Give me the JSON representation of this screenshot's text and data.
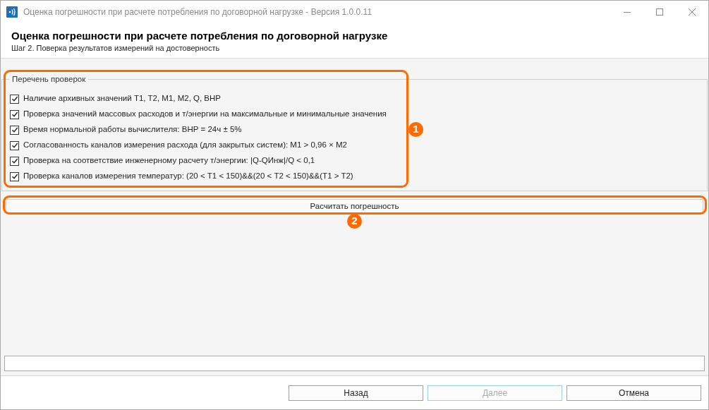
{
  "window": {
    "title": "Оценка погрешности при расчете потребления по договорной нагрузке - Версия 1.0.0.11"
  },
  "header": {
    "title": "Оценка погрешности при расчете потребления по договорной нагрузке",
    "subtitle": "Шаг 2. Поверка результатов измерений на достоверность"
  },
  "checks_group": {
    "title": "Перечень проверок",
    "items": [
      {
        "label": "Наличие архивных значений T1, T2, M1, M2, Q, ВНР",
        "checked": true
      },
      {
        "label": "Проверка значений массовых расходов и т/энергии на максимальные и минимальные значения",
        "checked": true
      },
      {
        "label": "Время нормальной работы вычислителя: ВНР = 24ч ± 5%",
        "checked": true
      },
      {
        "label": "Согласованность каналов измерения расхода (для закрытых систем): M1 > 0,96 × M2",
        "checked": true
      },
      {
        "label": "Проверка на соответствие инженерному расчету т/энергии: |Q-QИнж|/Q < 0,1",
        "checked": true
      },
      {
        "label": "Проверка каналов измерения температур: (20 < T1 < 150)&&(20 < T2 < 150)&&(T1 > T2)",
        "checked": true
      }
    ]
  },
  "calculate_button": {
    "label": "Расчитать погрешность"
  },
  "annotations": [
    {
      "label": "1"
    },
    {
      "label": "2"
    }
  ],
  "buttons": [
    {
      "label": "Назад",
      "disabled": false
    },
    {
      "label": "Далее",
      "disabled": true
    },
    {
      "label": "Отмена",
      "disabled": false
    }
  ]
}
